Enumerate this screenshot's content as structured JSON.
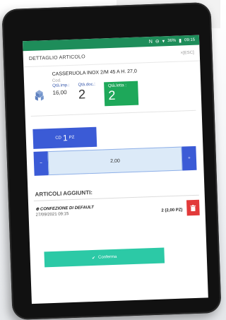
{
  "status_bar": {
    "battery": "36%",
    "time": "09:15"
  },
  "header": {
    "title": "DETTAGLIO ARTICOLO",
    "close": "×[ESC]"
  },
  "article": {
    "name": "CASSERUOLA INOX 2/M 45 A H. 27,0",
    "cod_label": "Cod.",
    "qta_imp_label": "Qtà.imp.:",
    "qta_imp_value": "16,00",
    "qta_doc_label": "Qtà.doc.:",
    "qta_doc_value": "2",
    "qta_letta_label": "Qtà.letta :",
    "qta_letta_value": "2"
  },
  "unit_button": {
    "prefix": "CD",
    "number": "1",
    "suffix": "PZ"
  },
  "stepper": {
    "value": "2,00"
  },
  "added": {
    "title": "ARTICOLI AGGIUNTI:",
    "items": [
      {
        "name": "⊕ CONFEZIONE DI DEFAULT",
        "date": "27/09/2021 09:15",
        "qty": "2 (2,00 PZ)"
      }
    ]
  },
  "confirm": {
    "label": "Conferma"
  },
  "colors": {
    "status": "#1e8d5a",
    "primary": "#3b5bd6",
    "accent": "#1ea85a",
    "confirm": "#2cc9a6",
    "danger": "#e23a3a"
  }
}
